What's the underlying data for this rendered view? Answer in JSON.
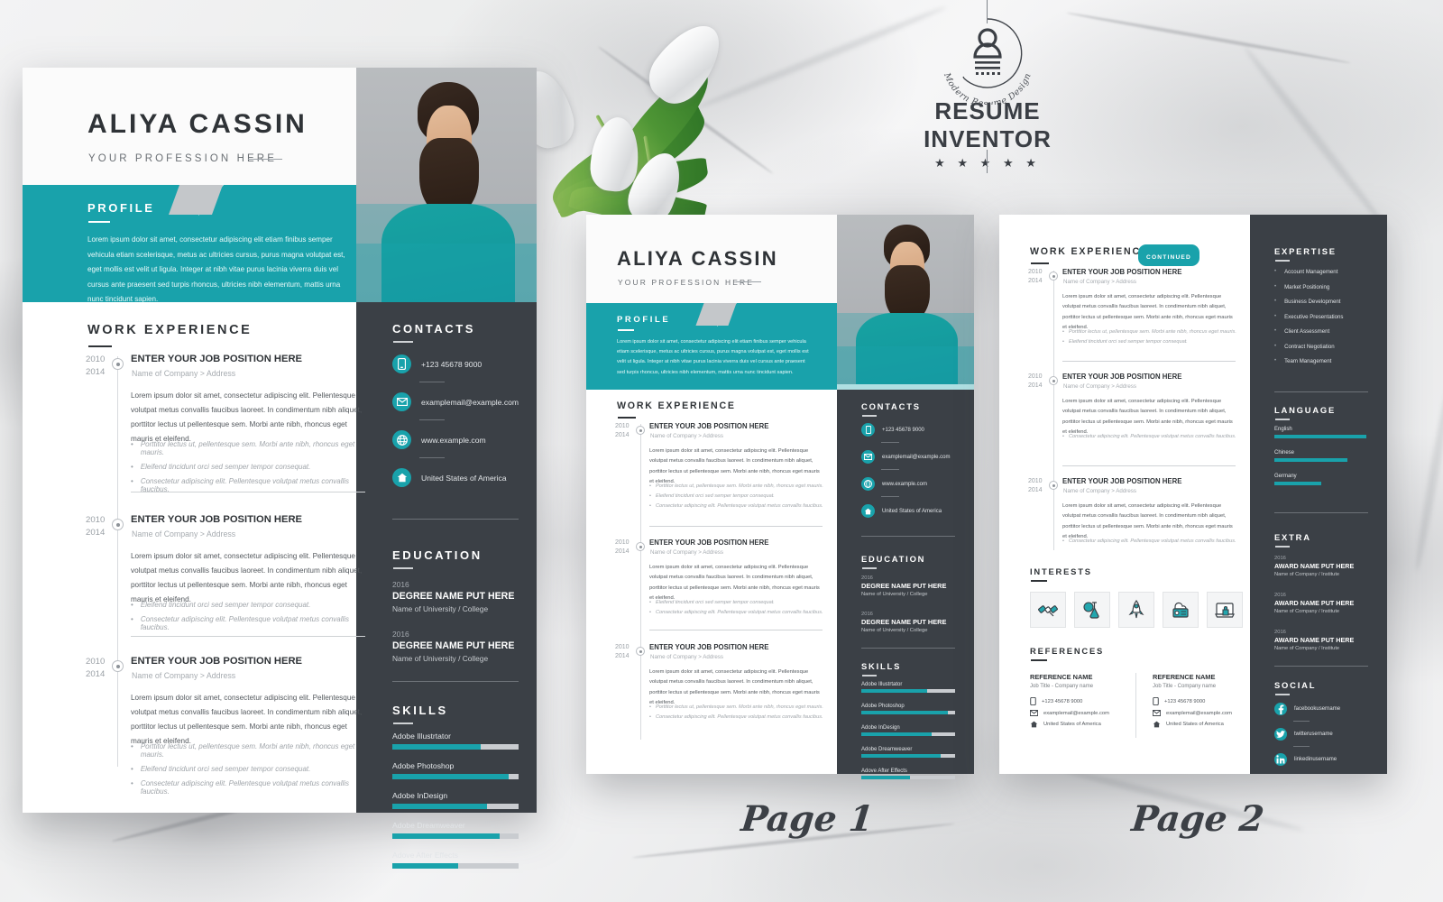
{
  "brand": {
    "logo_icon": "person-badge-icon",
    "curved_text": "Modern Resume Design",
    "title": "RESUME INVENTOR",
    "stars": "★ ★ ★ ★ ★",
    "accent_color": "#19a2ab",
    "dark_color": "#3b4046"
  },
  "page_labels": {
    "page1": "Page 1",
    "page2": "Page 2"
  },
  "resume": {
    "name": "ALIYA CASSIN",
    "profession": "YOUR PROFESSION HERE",
    "profile": {
      "heading": "PROFILE",
      "text": "Lorem ipsum dolor sit amet, consectetur adipiscing elit etiam finibus semper vehicula etiam scelerisque, metus ac ultricies cursus, purus magna volutpat est, eget mollis est velit ut ligula. Integer at nibh vitae purus lacinia viverra duis vel cursus ante praesent sed turpis rhoncus, ultricies nibh elementum, mattis urna nunc tincidunt sapien."
    },
    "work": {
      "heading": "WORK EXPERIENCE",
      "continued_badge": "CONTINUED",
      "entries": [
        {
          "year_from": "2010",
          "year_to": "2014",
          "title": "ENTER YOUR JOB POSITION HERE",
          "company": "Name of Company > Address",
          "body": "Lorem ipsum dolor sit amet, consectetur adipiscing elit. Pellentesque volutpat metus convallis faucibus laoreet. In condimentum nibh aliquet, porttitor lectus ut  pellentesque sem. Morbi ante nibh, rhoncus eget mauris et eleifend.",
          "bullets": [
            "Porttitor lectus ut, pellentesque sem. Morbi ante nibh, rhoncus eget mauris.",
            "Eleifend tincidunt orci sed semper tempor consequat.",
            "Consectetur adipiscing elit. Pellentesque volutpat metus convallis faucibus."
          ]
        },
        {
          "year_from": "2010",
          "year_to": "2014",
          "title": "ENTER YOUR JOB POSITION HERE",
          "company": "Name of Company > Address",
          "body": "Lorem ipsum dolor sit amet, consectetur adipiscing elit. Pellentesque volutpat metus convallis faucibus laoreet. In condimentum nibh aliquet, porttitor lectus ut  pellentesque sem. Morbi ante nibh, rhoncus eget mauris et eleifend.",
          "bullets": [
            "Eleifend tincidunt orci sed semper tempor consequat.",
            "Consectetur adipiscing elit. Pellentesque volutpat metus convallis faucibus."
          ]
        },
        {
          "year_from": "2010",
          "year_to": "2014",
          "title": "ENTER YOUR JOB POSITION HERE",
          "company": "Name of Company > Address",
          "body": "Lorem ipsum dolor sit amet, consectetur adipiscing elit. Pellentesque volutpat metus convallis faucibus laoreet. In condimentum nibh aliquet, porttitor lectus ut  pellentesque sem. Morbi ante nibh, rhoncus eget mauris et eleifend.",
          "bullets": [
            "Porttitor lectus ut, pellentesque sem. Morbi ante nibh, rhoncus eget mauris.",
            "Eleifend tincidunt orci sed semper tempor consequat.",
            "Consectetur adipiscing elit. Pellentesque volutpat metus convallis faucibus."
          ]
        }
      ]
    },
    "contacts": {
      "heading": "CONTACTS",
      "items": [
        {
          "icon": "phone-icon",
          "value": "+123 45678 9000"
        },
        {
          "icon": "email-icon",
          "value": "examplemail@example.com"
        },
        {
          "icon": "globe-icon",
          "value": "www.example.com"
        },
        {
          "icon": "home-icon",
          "value": "United States of America"
        }
      ]
    },
    "education": {
      "heading": "EDUCATION",
      "entries": [
        {
          "year": "2016",
          "degree": "DEGREE NAME PUT HERE",
          "school": "Name of University / College"
        },
        {
          "year": "2016",
          "degree": "DEGREE NAME PUT HERE",
          "school": "Name of University / College"
        }
      ]
    },
    "skills": {
      "heading": "SKILLS",
      "items": [
        {
          "label": "Adobe Illustrtator",
          "level": 70
        },
        {
          "label": "Adobe Photoshop",
          "level": 92
        },
        {
          "label": "Adobe InDesign",
          "level": 75
        },
        {
          "label": "Adobe Dreamweaver",
          "level": 85
        },
        {
          "label": "Adove After Effects",
          "level": 52
        }
      ]
    },
    "expertise": {
      "heading": "EXPERTISE",
      "items": [
        "Account Management",
        "Market Positioning",
        "Business Development",
        "Executive Presentations",
        "Client Assessment",
        "Contract Negotiation",
        "Team Management"
      ]
    },
    "language": {
      "heading": "LANGUAGE",
      "items": [
        {
          "label": "English",
          "level": 98
        },
        {
          "label": "Chinese",
          "level": 78
        },
        {
          "label": "Germany",
          "level": 50
        }
      ]
    },
    "extra": {
      "heading": "EXTRA",
      "entries": [
        {
          "year": "2016",
          "award": "AWARD NAME PUT HERE",
          "org": "Name of Company / Institute"
        },
        {
          "year": "2016",
          "award": "AWARD NAME PUT HERE",
          "org": "Name of Company / Institute"
        },
        {
          "year": "2016",
          "award": "AWARD NAME PUT HERE",
          "org": "Name of Company / Institute"
        }
      ]
    },
    "social": {
      "heading": "SOCIAL",
      "items": [
        {
          "icon": "facebook-icon",
          "value": "facebookusername"
        },
        {
          "icon": "twitter-icon",
          "value": "twitterusername"
        },
        {
          "icon": "linkedin-icon",
          "value": "linkedinusername"
        }
      ]
    },
    "interests": {
      "heading": "INTERESTS",
      "icons": [
        "satellite-icon",
        "flask-icon",
        "rocket-icon",
        "radio-cloud-icon",
        "laptop-bag-icon"
      ]
    },
    "references": {
      "heading": "REFERENCES",
      "entries": [
        {
          "name": "REFERENCE NAME",
          "role": "Job Title - Company name",
          "phone": "+123 45678 9000",
          "email": "examplemail@example.com",
          "location": "United States of America"
        },
        {
          "name": "REFERENCE NAME",
          "role": "Job Title - Company name",
          "phone": "+123 45678 9000",
          "email": "examplemail@example.com",
          "location": "United States of America"
        }
      ]
    },
    "photo_alt": "portrait-photo"
  }
}
